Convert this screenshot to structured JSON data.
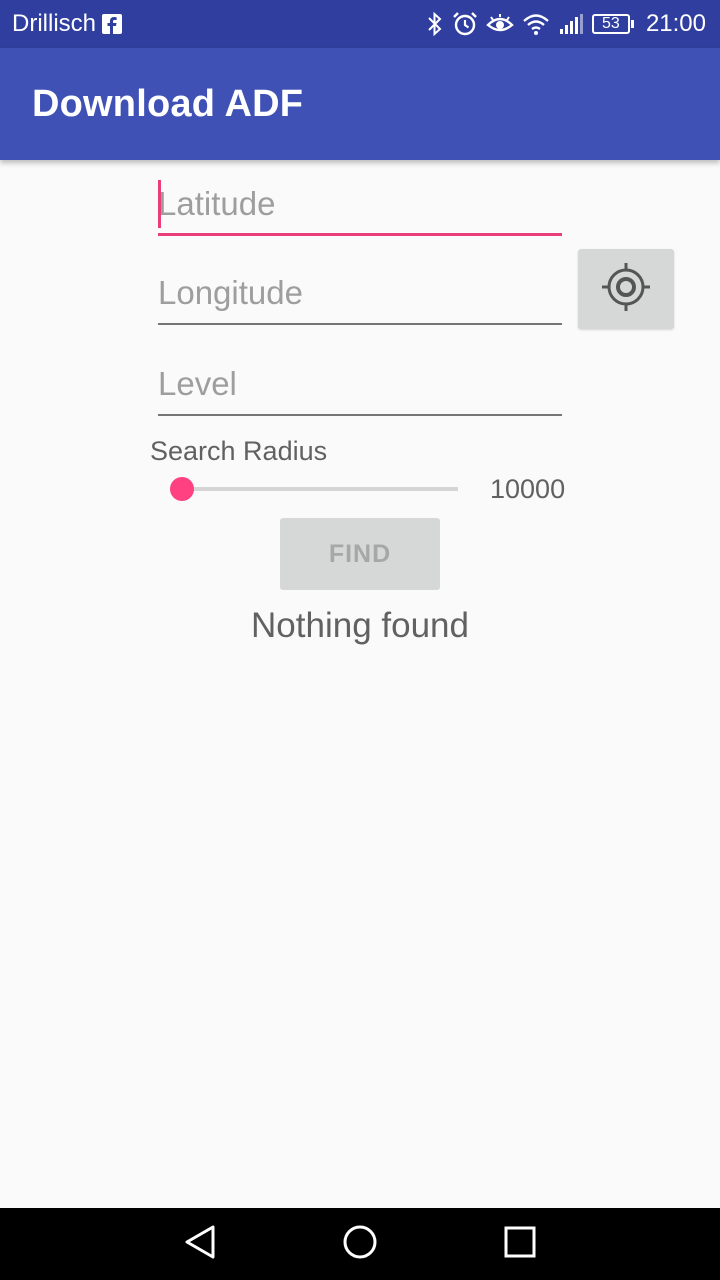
{
  "status_bar": {
    "carrier": "Drillisch",
    "battery": "53",
    "time": "21:00",
    "icons": [
      "facebook-icon",
      "bluetooth-icon",
      "alarm-icon",
      "eye-icon",
      "wifi-icon",
      "signal-icon",
      "battery-icon"
    ]
  },
  "app_bar": {
    "title": "Download ADF",
    "color": "#3f51b5"
  },
  "form": {
    "latitude": {
      "placeholder": "Latitude",
      "value": ""
    },
    "longitude": {
      "placeholder": "Longitude",
      "value": ""
    },
    "level": {
      "placeholder": "Level",
      "value": ""
    },
    "locate_icon": "my-location-icon",
    "search_radius_label": "Search Radius",
    "search_radius_value": "10000",
    "slider_position": 0,
    "find_label": "FIND",
    "accent_color": "#ff4081"
  },
  "result": {
    "text": "Nothing found"
  },
  "nav_bar": {
    "icons": [
      "back-icon",
      "home-icon",
      "recents-icon"
    ]
  }
}
